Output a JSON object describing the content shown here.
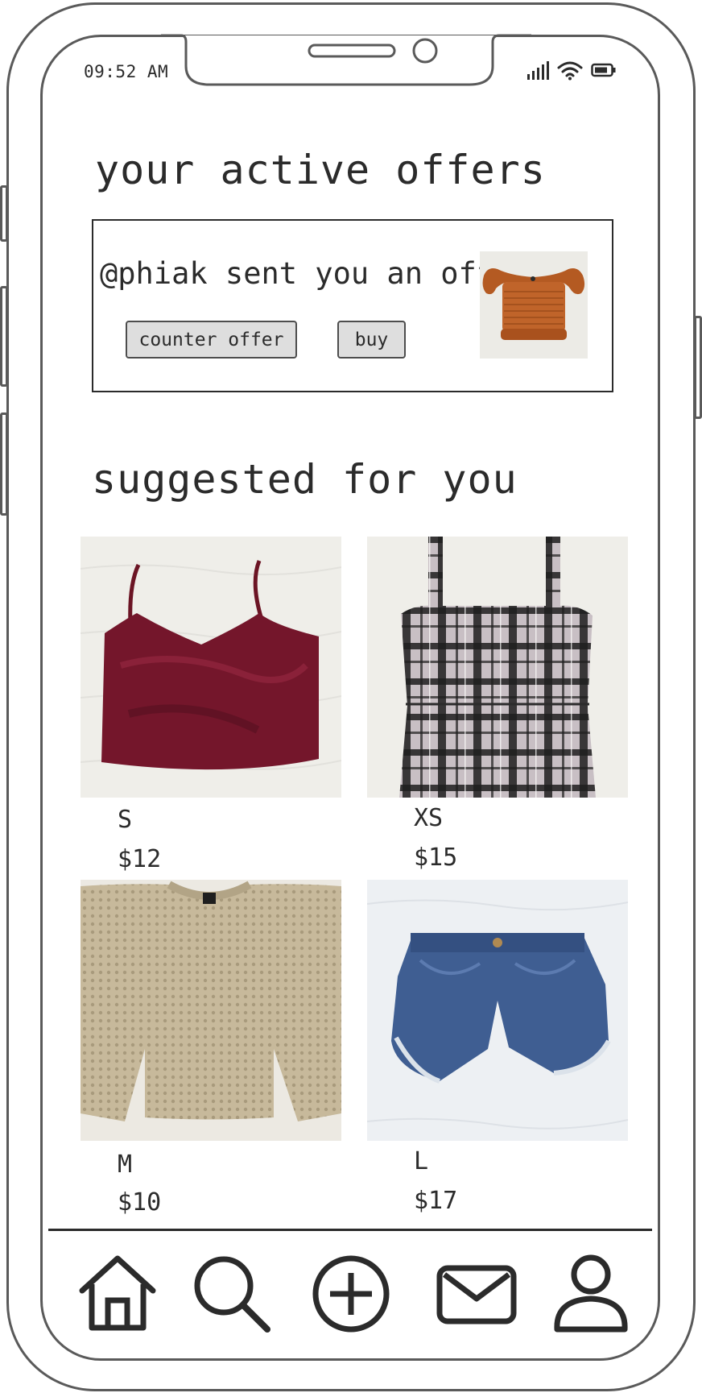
{
  "status_bar": {
    "time": "09:52 AM",
    "icons": [
      "signal-icon",
      "wifi-icon",
      "battery-icon"
    ]
  },
  "offers": {
    "title": "your active offers",
    "items": [
      {
        "message": "@phiak sent you an offer",
        "counter_label": "counter offer",
        "buy_label": "buy",
        "thumbnail": "orange-smocked-crop-top-photo"
      }
    ]
  },
  "suggested": {
    "title": "suggested for you",
    "products": [
      {
        "size": "S",
        "price": "$12",
        "image": "burgundy-velvet-cami-photo"
      },
      {
        "size": "XS",
        "price": "$15",
        "image": "plaid-pinafore-dress-photo"
      },
      {
        "size": "M",
        "price": "$10",
        "image": "beige-knit-sweater-photo"
      },
      {
        "size": "L",
        "price": "$17",
        "image": "denim-cutoff-shorts-photo"
      }
    ]
  },
  "bottom_nav": {
    "items": [
      "home-icon",
      "search-icon",
      "add-icon",
      "messages-icon",
      "profile-icon"
    ]
  },
  "colors": {
    "frame": "#5a5a5a",
    "text": "#2b2b2b",
    "button_fill": "#dedede",
    "photo_background": "#f0efea"
  }
}
